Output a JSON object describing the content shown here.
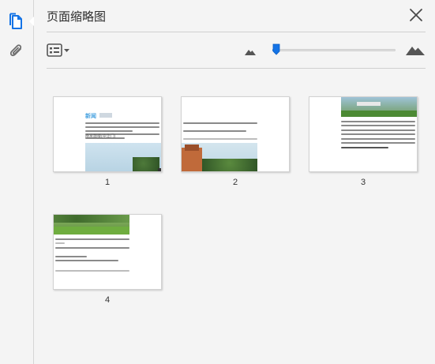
{
  "panel": {
    "title": "页面缩略图"
  },
  "toolbar": {
    "zoom_level": 0.02
  },
  "pages": [
    {
      "label": "1"
    },
    {
      "label": "2"
    },
    {
      "label": "3"
    },
    {
      "label": "4"
    }
  ],
  "thumb_text": {
    "p1_header": "新闻",
    "p1_caption": "南京鼓楼(中华门)"
  },
  "icons": {
    "rail_thumbnails": "page-thumbnails-icon",
    "rail_attachments": "paperclip-icon",
    "close": "close-icon",
    "view_options": "list-view-dropdown-icon",
    "zoom_out": "mountain-small-icon",
    "zoom_in": "mountain-large-icon"
  },
  "colors": {
    "accent": "#1473e6",
    "background": "#f4f4f4"
  }
}
